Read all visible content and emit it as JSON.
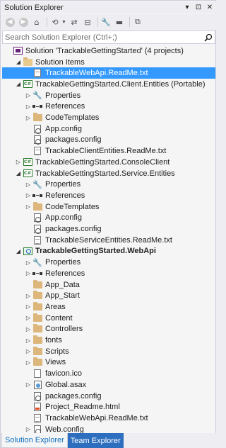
{
  "window": {
    "title": "Solution Explorer",
    "controls": {
      "pin": "▾",
      "dock": "⊡",
      "close": "✕"
    }
  },
  "toolbar": {
    "buttons": [
      "back",
      "forward",
      "home",
      "history",
      "sync",
      "properties",
      "collapse",
      "view"
    ]
  },
  "search": {
    "placeholder": "Search Solution Explorer (Ctrl+;)"
  },
  "tree": {
    "items": [
      {
        "label": "Solution 'TrackableGettingStarted' (4 projects)",
        "level": 0,
        "expander": "",
        "icon": "solution-icon"
      },
      {
        "label": "Solution Items",
        "level": 1,
        "expander": "◢",
        "icon": "folder-open-icon"
      },
      {
        "label": "TrackableWebApi.ReadMe.txt",
        "level": 2,
        "expander": "",
        "icon": "text-file-icon",
        "selected": true
      },
      {
        "label": "TrackableGettingStarted.Client.Entities (Portable)",
        "level": 1,
        "expander": "◢",
        "icon": "csharp-project-icon"
      },
      {
        "label": "Properties",
        "level": 2,
        "expander": "▷",
        "icon": "wrench-icon"
      },
      {
        "label": "References",
        "level": 2,
        "expander": "▷",
        "icon": "references-icon"
      },
      {
        "label": "CodeTemplates",
        "level": 2,
        "expander": "▷",
        "icon": "folder-icon"
      },
      {
        "label": "App.config",
        "level": 2,
        "expander": "",
        "icon": "config-file-icon"
      },
      {
        "label": "packages.config",
        "level": 2,
        "expander": "",
        "icon": "config-file-icon"
      },
      {
        "label": "TrackableClientEntities.ReadMe.txt",
        "level": 2,
        "expander": "",
        "icon": "text-file-icon"
      },
      {
        "label": "TrackableGettingStarted.ConsoleClient",
        "level": 1,
        "expander": "▷",
        "icon": "csharp-project-icon"
      },
      {
        "label": "TrackableGettingStarted.Service.Entities",
        "level": 1,
        "expander": "◢",
        "icon": "csharp-project-icon"
      },
      {
        "label": "Properties",
        "level": 2,
        "expander": "▷",
        "icon": "wrench-icon"
      },
      {
        "label": "References",
        "level": 2,
        "expander": "▷",
        "icon": "references-icon"
      },
      {
        "label": "CodeTemplates",
        "level": 2,
        "expander": "▷",
        "icon": "folder-icon"
      },
      {
        "label": "App.config",
        "level": 2,
        "expander": "",
        "icon": "config-file-icon"
      },
      {
        "label": "packages.config",
        "level": 2,
        "expander": "",
        "icon": "config-file-icon"
      },
      {
        "label": "TrackableServiceEntities.ReadMe.txt",
        "level": 2,
        "expander": "",
        "icon": "text-file-icon"
      },
      {
        "label": "TrackableGettingStarted.WebApi",
        "level": 1,
        "expander": "◢",
        "icon": "web-project-icon",
        "bold": true
      },
      {
        "label": "Properties",
        "level": 2,
        "expander": "▷",
        "icon": "wrench-icon"
      },
      {
        "label": "References",
        "level": 2,
        "expander": "▷",
        "icon": "references-icon"
      },
      {
        "label": "App_Data",
        "level": 2,
        "expander": "",
        "icon": "folder-icon"
      },
      {
        "label": "App_Start",
        "level": 2,
        "expander": "▷",
        "icon": "folder-icon"
      },
      {
        "label": "Areas",
        "level": 2,
        "expander": "▷",
        "icon": "folder-icon"
      },
      {
        "label": "Content",
        "level": 2,
        "expander": "▷",
        "icon": "folder-icon"
      },
      {
        "label": "Controllers",
        "level": 2,
        "expander": "▷",
        "icon": "folder-icon"
      },
      {
        "label": "fonts",
        "level": 2,
        "expander": "▷",
        "icon": "folder-icon"
      },
      {
        "label": "Scripts",
        "level": 2,
        "expander": "▷",
        "icon": "folder-icon"
      },
      {
        "label": "Views",
        "level": 2,
        "expander": "▷",
        "icon": "folder-icon"
      },
      {
        "label": "favicon.ico",
        "level": 2,
        "expander": "",
        "icon": "image-file-icon"
      },
      {
        "label": "Global.asax",
        "level": 2,
        "expander": "▷",
        "icon": "asax-file-icon"
      },
      {
        "label": "packages.config",
        "level": 2,
        "expander": "",
        "icon": "config-file-icon"
      },
      {
        "label": "Project_Readme.html",
        "level": 2,
        "expander": "",
        "icon": "html-file-icon"
      },
      {
        "label": "TrackableWebApi.ReadMe.txt",
        "level": 2,
        "expander": "",
        "icon": "text-file-icon"
      },
      {
        "label": "Web.config",
        "level": 2,
        "expander": "▷",
        "icon": "config-file-icon"
      }
    ]
  },
  "tabs": [
    {
      "label": "Solution Explorer",
      "active": true
    },
    {
      "label": "Team Explorer",
      "active": false
    }
  ],
  "colors": {
    "selection": "#3399ff",
    "accent_tab_text": "#0e70c0",
    "inactive_tab_bg": "#2d6ebf"
  }
}
